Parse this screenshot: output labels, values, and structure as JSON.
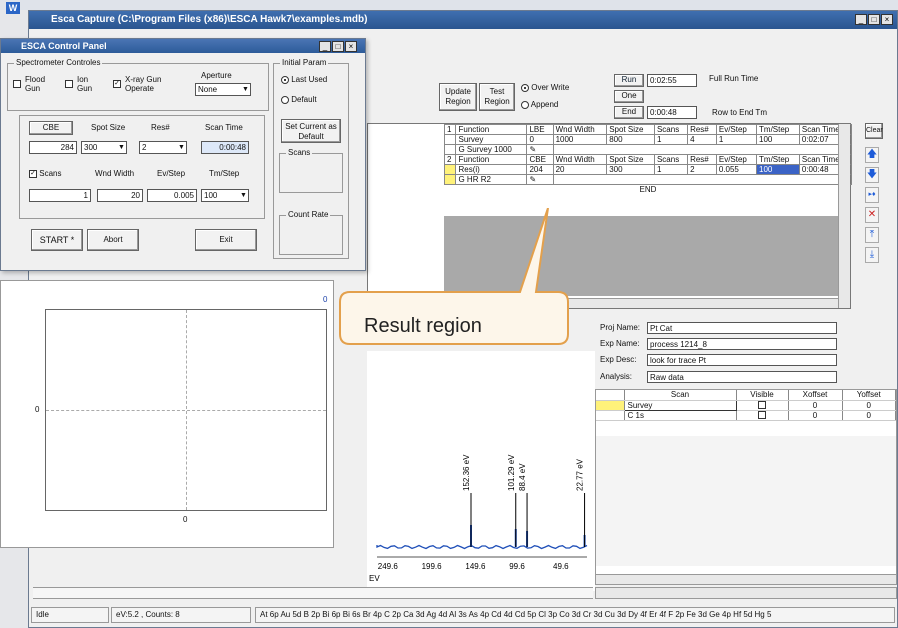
{
  "main_title": "Esca Capture (C:\\Program Files (x86)\\ESCA Hawk7\\examples.mdb)",
  "titlebar_buttons": [
    "_",
    "□",
    "×"
  ],
  "panel": {
    "title": "ESCA Control Panel",
    "spec_group": "Spectrometer Controles",
    "flood_gun": "Flood Gun",
    "ion_gun": "Ion Gun",
    "xray": "X-ray Gun Operate",
    "aperture_label": "Aperture",
    "aperture_value": "None",
    "init_group": "Initial Param",
    "last_used": "Last Used",
    "default": "Default",
    "set_current": "Set Current as Default",
    "scans_group": "Scans",
    "count_rate_group": "Count Rate",
    "cbe_hdr": "CBE",
    "spot_hdr": "Spot Size",
    "res_hdr": "Res#",
    "scan_time_hdr": "Scan Time",
    "cbe_val": "284",
    "spot_val": "300",
    "res_val": "2",
    "scan_time_val": "0:00:48",
    "scans_label": "Scans",
    "wnd_hdr": "Wnd Width",
    "ev_hdr": "Ev/Step",
    "tm_hdr": "Tm/Step",
    "scans_val": "1",
    "wnd_val": "20",
    "ev_val": "0.005",
    "tm_val": "100",
    "start": "START *",
    "abort": "Abort",
    "exit": "Exit"
  },
  "region": {
    "update": "Update Region",
    "test": "Test Region",
    "overwrite": "Over Write",
    "append": "Append",
    "run": "Run",
    "one": "One",
    "end": "End",
    "run_time": "0:02:55",
    "full_run": "Full Run Time",
    "end_time": "0:00:48",
    "row_to_end": "Row to End Tm"
  },
  "grid": {
    "header1": [
      "1",
      "Function",
      "LBE",
      "Wnd Width",
      "Spot Size",
      "Scans",
      "Res#",
      "Ev/Step",
      "Tm/Step",
      "Scan Time"
    ],
    "row1": [
      "",
      "Survey",
      "0",
      "1000",
      "800",
      "1",
      "4",
      "1",
      "100",
      "0:02:07"
    ],
    "row1b": [
      "",
      "G Survey 1000",
      "",
      "",
      "",
      "",
      "",
      "",
      "",
      ""
    ],
    "header2": [
      "2",
      "Function",
      "CBE",
      "Wnd Width",
      "Spot Size",
      "Scans",
      "Res#",
      "Ev/Step",
      "Tm/Step",
      "Scan Time"
    ],
    "row2": [
      "",
      "Res(i)",
      "204",
      "20",
      "300",
      "1",
      "2",
      "0.055",
      "100",
      "0:00:48"
    ],
    "row2b": [
      "",
      "G HR R2",
      "",
      "",
      "",
      "",
      "",
      "",
      "",
      ""
    ],
    "end": "END",
    "clear": "Clear"
  },
  "callout": "Result region",
  "proj": {
    "proj_name_lbl": "Proj Name:",
    "proj_name": "Pt Cat",
    "exp_name_lbl": "Exp Name:",
    "exp_name": "process 1214_8",
    "exp_desc_lbl": "Exp Desc:",
    "exp_desc": "look for trace Pt",
    "analysis_lbl": "Analysis:",
    "analysis": "Raw data"
  },
  "scan_table": {
    "headers": [
      "Scan",
      "Visible",
      "Xoffset",
      "Yoffset"
    ],
    "rows": [
      [
        "Survey",
        "",
        "0",
        "0"
      ],
      [
        "C 1s",
        "",
        "0",
        "0"
      ]
    ]
  },
  "left_plot": {
    "y0": "0",
    "x0": "0",
    "corner": "0"
  },
  "spectrum": {
    "peaks": [
      {
        "label": "152.36 eV",
        "x": 152.36,
        "h": 0.55
      },
      {
        "label": "101.29 eV",
        "x": 101.29,
        "h": 0.45
      },
      {
        "label": "88.4 eV",
        "x": 88.4,
        "h": 0.4
      },
      {
        "label": "22.77 eV",
        "x": 22.77,
        "h": 0.3
      }
    ],
    "ticks": [
      "249.6",
      "199.6",
      "149.6",
      "99.6",
      "49.6"
    ],
    "unit": "EV"
  },
  "status": {
    "state": "Idle",
    "counts": "eV:5.2 , Counts: 8",
    "elements": "At 6p Au 5d B 2p Bi 6p Bi 6s Br 4p C 2p Ca 3d Ag 4d Al 3s As 4p Cd 4d Cd 5p Cl 3p Co 3d Cr 3d Cu 3d Dy 4f Er 4f F 2p Fe 3d Ge 4p Hf 5d Hg 5"
  },
  "colors": {
    "title": "#2a558f",
    "callout_fill": "#fdf6ea",
    "callout_border": "#e3a04c",
    "highlight": "#fff27a",
    "selection": "#3b63c6"
  }
}
